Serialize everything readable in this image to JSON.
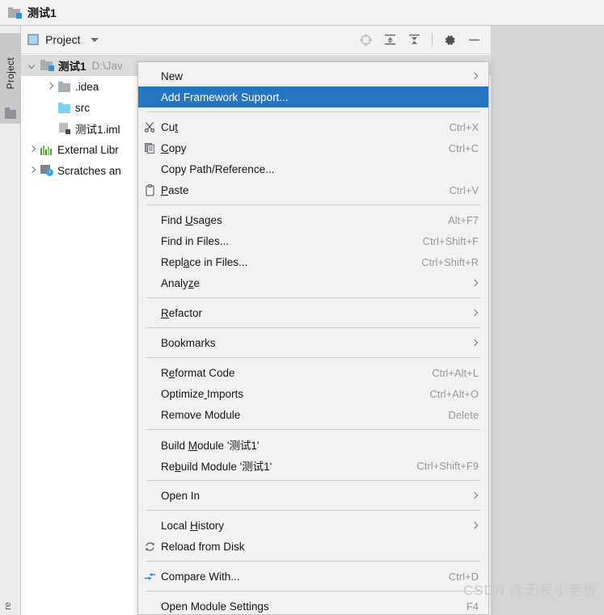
{
  "titlebar": {
    "project_name": "测试1",
    "icon": "module-folder-icon"
  },
  "toolwindow_strip": {
    "tab_label": "Project",
    "bottom_tab_label": "re",
    "folder_icon": "folder-icon"
  },
  "panel": {
    "toolbar": {
      "view_label": "Project",
      "view_icon": "project-view-icon",
      "dropdown_icon": "chevron-down-icon",
      "buttons": [
        {
          "name": "locate-icon",
          "title": "Select Opened File"
        },
        {
          "name": "expand-all-icon",
          "title": "Expand All"
        },
        {
          "name": "collapse-all-icon",
          "title": "Collapse All"
        },
        {
          "name": "gear-icon",
          "title": "Show Options Menu"
        },
        {
          "name": "minimize-icon",
          "title": "Hide"
        }
      ]
    },
    "tree": [
      {
        "label": "测试1",
        "path": "D:\\Jav",
        "icon": "module-folder-icon",
        "arrow": "down",
        "indent": 0,
        "selected": true,
        "bold": true
      },
      {
        "label": ".idea",
        "path": "",
        "icon": "folder-grey-icon",
        "arrow": "right",
        "indent": 1,
        "selected": false,
        "bold": false
      },
      {
        "label": "src",
        "path": "",
        "icon": "folder-source-icon",
        "arrow": "none",
        "indent": 1,
        "selected": false,
        "bold": false
      },
      {
        "label": "测试1.iml",
        "path": "",
        "icon": "iml-file-icon",
        "arrow": "none",
        "indent": 1,
        "selected": false,
        "bold": false
      },
      {
        "label": "External Libr",
        "path": "",
        "icon": "external-libraries-icon",
        "arrow": "right",
        "indent": 0,
        "selected": false,
        "bold": false
      },
      {
        "label": "Scratches an",
        "path": "",
        "icon": "scratches-icon",
        "arrow": "right",
        "indent": 0,
        "selected": false,
        "bold": false
      }
    ]
  },
  "context_menu": {
    "highlight_color": "#2675bf",
    "background_color": "#f2f2f2",
    "items": [
      {
        "type": "item",
        "label": "New",
        "accel": "",
        "icon": "",
        "submenu": true,
        "highlighted": false
      },
      {
        "type": "item",
        "label": "Add Framework Support...",
        "accel": "",
        "icon": "",
        "submenu": false,
        "highlighted": true
      },
      {
        "type": "separator"
      },
      {
        "type": "item",
        "label": "Cut",
        "accel": "Ctrl+X",
        "icon": "scissors-icon",
        "submenu": false,
        "highlighted": false
      },
      {
        "type": "item",
        "label": "Copy",
        "accel": "Ctrl+C",
        "icon": "copy-icon",
        "submenu": false,
        "highlighted": false
      },
      {
        "type": "item",
        "label": "Copy Path/Reference...",
        "accel": "",
        "icon": "",
        "submenu": false,
        "highlighted": false
      },
      {
        "type": "item",
        "label": "Paste",
        "accel": "Ctrl+V",
        "icon": "paste-icon",
        "submenu": false,
        "highlighted": false
      },
      {
        "type": "separator"
      },
      {
        "type": "item",
        "label": "Find Usages",
        "accel": "Alt+F7",
        "icon": "",
        "submenu": false,
        "highlighted": false
      },
      {
        "type": "item",
        "label": "Find in Files...",
        "accel": "Ctrl+Shift+F",
        "icon": "",
        "submenu": false,
        "highlighted": false
      },
      {
        "type": "item",
        "label": "Replace in Files...",
        "accel": "Ctrl+Shift+R",
        "icon": "",
        "submenu": false,
        "highlighted": false
      },
      {
        "type": "item",
        "label": "Analyze",
        "accel": "",
        "icon": "",
        "submenu": true,
        "highlighted": false
      },
      {
        "type": "separator"
      },
      {
        "type": "item",
        "label": "Refactor",
        "accel": "",
        "icon": "",
        "submenu": true,
        "highlighted": false
      },
      {
        "type": "separator"
      },
      {
        "type": "item",
        "label": "Bookmarks",
        "accel": "",
        "icon": "",
        "submenu": true,
        "highlighted": false
      },
      {
        "type": "separator"
      },
      {
        "type": "item",
        "label": "Reformat Code",
        "accel": "Ctrl+Alt+L",
        "icon": "",
        "submenu": false,
        "highlighted": false
      },
      {
        "type": "item",
        "label": "Optimize Imports",
        "accel": "Ctrl+Alt+O",
        "icon": "",
        "submenu": false,
        "highlighted": false
      },
      {
        "type": "item",
        "label": "Remove Module",
        "accel": "Delete",
        "icon": "",
        "submenu": false,
        "highlighted": false
      },
      {
        "type": "separator"
      },
      {
        "type": "item",
        "label": "Build Module '测试1'",
        "accel": "",
        "icon": "",
        "submenu": false,
        "highlighted": false
      },
      {
        "type": "item",
        "label": "Rebuild Module '测试1'",
        "accel": "Ctrl+Shift+F9",
        "icon": "",
        "submenu": false,
        "highlighted": false
      },
      {
        "type": "separator"
      },
      {
        "type": "item",
        "label": "Open In",
        "accel": "",
        "icon": "",
        "submenu": true,
        "highlighted": false
      },
      {
        "type": "separator"
      },
      {
        "type": "item",
        "label": "Local History",
        "accel": "",
        "icon": "",
        "submenu": true,
        "highlighted": false
      },
      {
        "type": "item",
        "label": "Reload from Disk",
        "accel": "",
        "icon": "reload-icon",
        "submenu": false,
        "highlighted": false
      },
      {
        "type": "separator"
      },
      {
        "type": "item",
        "label": "Compare With...",
        "accel": "Ctrl+D",
        "icon": "compare-icon",
        "submenu": false,
        "highlighted": false
      },
      {
        "type": "separator"
      },
      {
        "type": "item",
        "label": "Open Module Settings",
        "accel": "F4",
        "icon": "",
        "submenu": false,
        "highlighted": false
      }
    ]
  },
  "watermark": {
    "text": "CSDN @无良小老板"
  }
}
